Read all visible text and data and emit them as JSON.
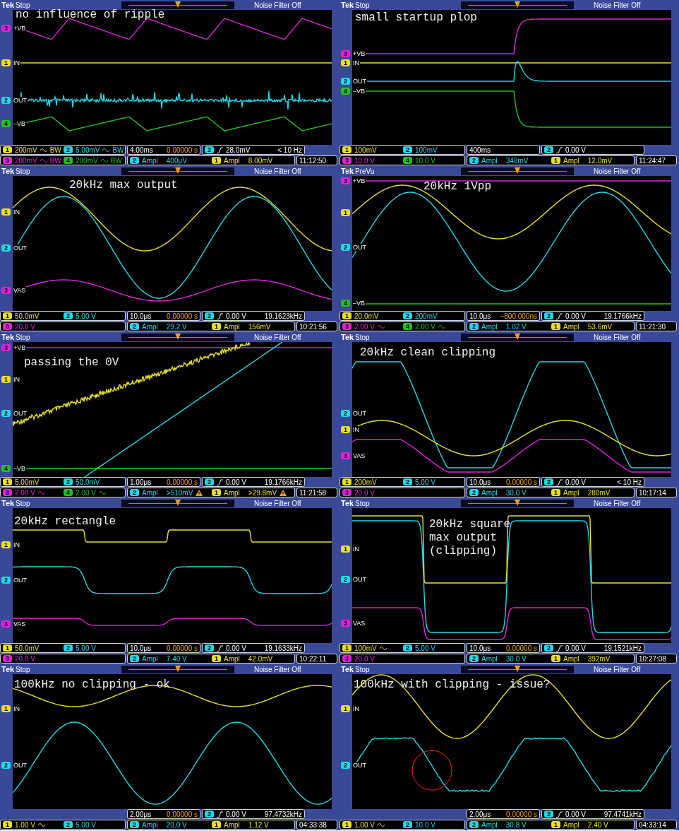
{
  "panels": [
    {
      "kind": "ripple",
      "brand": "Tek",
      "status": "Stop",
      "filter": "Noise Filter Off",
      "annotation": "no influence of ripple",
      "markers": [
        {
          "ch": "3",
          "label": "+VB",
          "color": "#e020e0"
        },
        {
          "ch": "1",
          "label": "IN",
          "color": "#e8e020"
        },
        {
          "ch": "2",
          "label": "OUT",
          "color": "#20d8e8"
        },
        {
          "ch": "4",
          "label": "–VB",
          "color": "#20c020"
        }
      ],
      "scales": [
        [
          {
            "ch": "1",
            "value": "200mV",
            "color": "#e8e020",
            "wave": true,
            "suffix": "BW"
          },
          {
            "ch": "2",
            "value": "5.00mV",
            "color": "#20d8e8",
            "wave": true,
            "suffix": "BW"
          }
        ],
        [
          {
            "ch": "3",
            "value": "200mV",
            "color": "#e020e0",
            "wave": true,
            "suffix": "BW"
          },
          {
            "ch": "4",
            "value": "200mV",
            "color": "#20c020",
            "wave": true,
            "suffix": "BW"
          }
        ]
      ],
      "timebase": "4.00ms",
      "delay": "0.00000 s",
      "trigger": {
        "ch": "2",
        "value": "28.0mV",
        "color": "#20d8e8"
      },
      "frequency": "< 10 Hz",
      "measurements": [
        {
          "ch": "2",
          "label": "Ampl",
          "value": "400μV",
          "color": "#20d8e8",
          "warning": false
        },
        {
          "ch": "1",
          "label": "Ampl",
          "value": "8.00mV",
          "color": "#e8e020",
          "warning": false
        }
      ],
      "time": "11:12:50"
    },
    {
      "kind": "startup",
      "brand": "Tek",
      "status": "Stop",
      "filter": "Noise Filter Off",
      "annotation": "small startup plop",
      "markers": [
        {
          "ch": "3",
          "label": "+VB",
          "color": "#e020e0"
        },
        {
          "ch": "1",
          "label": "IN",
          "color": "#e8e020"
        },
        {
          "ch": "2",
          "label": "OUT",
          "color": "#20d8e8"
        },
        {
          "ch": "4",
          "label": "–VB",
          "color": "#20c020"
        }
      ],
      "scales": [
        [
          {
            "ch": "1",
            "value": "100mV",
            "color": "#e8e020",
            "wave": false
          },
          {
            "ch": "2",
            "value": "100mV",
            "color": "#20d8e8",
            "wave": false
          }
        ],
        [
          {
            "ch": "3",
            "value": "10.0 V",
            "color": "#e020e0",
            "wave": false
          },
          {
            "ch": "4",
            "value": "10.0 V",
            "color": "#20c020",
            "wave": false
          }
        ]
      ],
      "timebase": "400ms",
      "trigger": {
        "ch": "2",
        "value": "0.00 V",
        "color": "#20d8e8"
      },
      "measurements": [
        {
          "ch": "2",
          "label": "Ampl",
          "value": "348mV",
          "color": "#20d8e8",
          "warning": false
        },
        {
          "ch": "1",
          "label": "Ampl",
          "value": "12.0mV",
          "color": "#e8e020",
          "warning": false
        }
      ],
      "time": "11:24:47"
    },
    {
      "kind": "sine_max",
      "brand": "Tek",
      "status": "Stop",
      "filter": "Noise Filter Off",
      "annotation": "20kHz max output",
      "markers": [
        {
          "ch": "1",
          "label": "IN",
          "color": "#e8e020"
        },
        {
          "ch": "2",
          "label": "OUT",
          "color": "#20d8e8"
        },
        {
          "ch": "3",
          "label": "VAS",
          "color": "#e020e0"
        }
      ],
      "scales": [
        [
          {
            "ch": "1",
            "value": "50.0mV",
            "color": "#e8e020",
            "wave": false
          },
          {
            "ch": "2",
            "value": "5.00 V",
            "color": "#20d8e8",
            "wave": false
          }
        ],
        [
          {
            "ch": "3",
            "value": "20.0 V",
            "color": "#e020e0",
            "wave": false
          }
        ]
      ],
      "timebase": "10.0μs",
      "delay": "0.00000 s",
      "trigger": {
        "ch": "2",
        "value": "0.00 V",
        "color": "#20d8e8"
      },
      "frequency": "19.1623kHz",
      "measurements": [
        {
          "ch": "2",
          "label": "Ampl",
          "value": "29.2 V",
          "color": "#20d8e8",
          "warning": false
        },
        {
          "ch": "1",
          "label": "Ampl",
          "value": "156mV",
          "color": "#e8e020",
          "warning": false
        }
      ],
      "time": "10:21:56"
    },
    {
      "kind": "sine_1vpp",
      "brand": "Tek",
      "status": "PreVu",
      "filter": "Noise Filter Off",
      "annotation": "20kHz 1Vpp",
      "markers": [
        {
          "ch": "3",
          "label": "+VB",
          "color": "#e020e0"
        },
        {
          "ch": "1",
          "color": "#e8e020"
        },
        {
          "ch": "2",
          "label": "OUT",
          "color": "#20d8e8"
        },
        {
          "ch": "4",
          "label": "–VB",
          "color": "#20c020"
        }
      ],
      "scales": [
        [
          {
            "ch": "1",
            "value": "20.0mV",
            "color": "#e8e020",
            "wave": false
          },
          {
            "ch": "2",
            "value": "200mV",
            "color": "#20d8e8",
            "wave": false
          }
        ],
        [
          {
            "ch": "3",
            "value": "2.00 V",
            "color": "#e020e0",
            "wave": true
          },
          {
            "ch": "4",
            "value": "2.00 V",
            "color": "#20c020",
            "wave": true
          }
        ]
      ],
      "timebase": "10.0μs",
      "delay": "−800.000ns",
      "trigger": {
        "ch": "2",
        "value": "0.00 V",
        "color": "#20d8e8"
      },
      "frequency": "19.1766kHz",
      "measurements": [
        {
          "ch": "2",
          "label": "Ampl",
          "value": "1.02 V",
          "color": "#20d8e8",
          "warning": false
        },
        {
          "ch": "1",
          "label": "Ampl",
          "value": "53.6mV",
          "color": "#e8e020",
          "warning": false
        }
      ],
      "time": "11:21:30"
    },
    {
      "kind": "zero_cross",
      "brand": "Tek",
      "status": "Stop",
      "filter": "Noise Filter Off",
      "annotation": "passing the 0V",
      "markers": [
        {
          "ch": "3",
          "label": "+VB",
          "color": "#e020e0"
        },
        {
          "ch": "1",
          "label": "IN",
          "color": "#e8e020"
        },
        {
          "ch": "2",
          "label": "OUT",
          "color": "#20d8e8"
        },
        {
          "ch": "4",
          "label": "–VB",
          "color": "#20c020"
        }
      ],
      "scales": [
        [
          {
            "ch": "1",
            "value": "5.00mV",
            "color": "#e8e020",
            "wave": false
          },
          {
            "ch": "2",
            "value": "50.0mV",
            "color": "#20d8e8",
            "wave": false
          }
        ],
        [
          {
            "ch": "3",
            "value": "2.00 V",
            "color": "#e020e0",
            "wave": true
          },
          {
            "ch": "4",
            "value": "2.00 V",
            "color": "#20c020",
            "wave": true
          }
        ]
      ],
      "timebase": "1.00μs",
      "delay": "0.00000 s",
      "trigger": {
        "ch": "2",
        "value": "0.00 V",
        "color": "#20d8e8"
      },
      "frequency": "19.1766kHz",
      "measurements": [
        {
          "ch": "2",
          "label": "Ampl",
          "value": ">510mV",
          "color": "#20d8e8",
          "warning": true
        },
        {
          "ch": "1",
          "label": "Ampl",
          "value": ">29.8mV",
          "color": "#e8e020",
          "warning": true
        }
      ],
      "time": "11:21:58"
    },
    {
      "kind": "clean_clip",
      "brand": "Tek",
      "status": "Stop",
      "filter": "Noise Filter Off",
      "annotation": "20kHz clean clipping",
      "markers": [
        {
          "ch": "2",
          "label": "OUT",
          "color": "#20d8e8"
        },
        {
          "ch": "1",
          "label": "IN",
          "color": "#e8e020"
        },
        {
          "ch": "3",
          "label": "VAS",
          "color": "#e020e0"
        }
      ],
      "scales": [
        [
          {
            "ch": "1",
            "value": "200mV",
            "color": "#e8e020",
            "wave": false
          },
          {
            "ch": "2",
            "value": "5.00 V",
            "color": "#20d8e8",
            "wave": false
          }
        ],
        [
          {
            "ch": "3",
            "value": "20.0 V",
            "color": "#e020e0",
            "wave": false
          }
        ]
      ],
      "timebase": "10.0μs",
      "delay": "0.00000 s",
      "trigger": {
        "ch": "2",
        "value": "0.00 V",
        "color": "#20d8e8"
      },
      "frequency": "< 10 Hz",
      "measurements": [
        {
          "ch": "2",
          "label": "Ampl",
          "value": "30.0 V",
          "color": "#20d8e8",
          "warning": false
        },
        {
          "ch": "1",
          "label": "Ampl",
          "value": "280mV",
          "color": "#e8e020",
          "warning": false
        }
      ],
      "time": "10:17:14"
    },
    {
      "kind": "rectangle",
      "brand": "Tek",
      "status": "Stop",
      "filter": "Noise Filter Off",
      "annotation": "20kHz rectangle",
      "markers": [
        {
          "ch": "1",
          "label": "IN",
          "color": "#e8e020"
        },
        {
          "ch": "2",
          "label": "OUT",
          "color": "#20d8e8"
        },
        {
          "ch": "3",
          "label": "VAS",
          "color": "#e020e0"
        }
      ],
      "scales": [
        [
          {
            "ch": "1",
            "value": "50.0mV",
            "color": "#e8e020",
            "wave": false
          },
          {
            "ch": "2",
            "value": "5.00 V",
            "color": "#20d8e8",
            "wave": false
          }
        ],
        [
          {
            "ch": "3",
            "value": "20.0 V",
            "color": "#e020e0",
            "wave": false
          }
        ]
      ],
      "timebase": "10.0μs",
      "delay": "0.00000 s",
      "trigger": {
        "ch": "2",
        "value": "0.00 V",
        "color": "#20d8e8"
      },
      "frequency": "19.1633kHz",
      "measurements": [
        {
          "ch": "2",
          "label": "Ampl",
          "value": "7.40 V",
          "color": "#20d8e8",
          "warning": false
        },
        {
          "ch": "1",
          "label": "Ampl",
          "value": "42.0mV",
          "color": "#e8e020",
          "warning": false
        }
      ],
      "time": "10:22:11"
    },
    {
      "kind": "square_clip",
      "brand": "Tek",
      "status": "Stop",
      "filter": "Noise Filter Off",
      "annotation": "20kHz square\nmax output\n(clipping)",
      "markers": [
        {
          "ch": "1",
          "label": "IN",
          "color": "#e8e020"
        },
        {
          "ch": "2",
          "label": "OUT",
          "color": "#20d8e8"
        },
        {
          "ch": "3",
          "label": "VAS",
          "color": "#e020e0"
        }
      ],
      "scales": [
        [
          {
            "ch": "1",
            "value": "100mV",
            "color": "#e8e020",
            "wave": true
          },
          {
            "ch": "2",
            "value": "5.00 V",
            "color": "#20d8e8",
            "wave": false
          }
        ],
        [
          {
            "ch": "3",
            "value": "20.0 V",
            "color": "#e020e0",
            "wave": false
          }
        ]
      ],
      "timebase": "10.0μs",
      "delay": "0.00000 s",
      "trigger": {
        "ch": "2",
        "value": "0.00 V",
        "color": "#20d8e8"
      },
      "frequency": "19.1521kHz",
      "measurements": [
        {
          "ch": "2",
          "label": "Ampl",
          "value": "30.0 V",
          "color": "#20d8e8",
          "warning": false
        },
        {
          "ch": "1",
          "label": "Ampl",
          "value": "392mV",
          "color": "#e8e020",
          "warning": false
        }
      ],
      "time": "10:27:08"
    },
    {
      "kind": "sine_100k",
      "brand": "Tek",
      "status": "Stop",
      "filter": "Noise Filter Off",
      "annotation": "100kHz no clipping - ok",
      "markers": [
        {
          "ch": "1",
          "label": "IN",
          "color": "#e8e020"
        },
        {
          "ch": "2",
          "label": "OUT",
          "color": "#20d8e8"
        }
      ],
      "scales": [
        [
          {
            "ch": "1",
            "value": "1.00 V",
            "color": "#e8e020",
            "wave": true
          },
          {
            "ch": "2",
            "value": "5.00 V",
            "color": "#20d8e8",
            "wave": false
          }
        ]
      ],
      "timebase": "2.00μs",
      "delay": "0.00000 s",
      "trigger": {
        "ch": "2",
        "value": "0.00 V",
        "color": "#20d8e8"
      },
      "frequency": "97.4732kHz",
      "measurements": [
        {
          "ch": "2",
          "label": "Ampl",
          "value": "20.0 V",
          "color": "#20d8e8",
          "warning": false
        },
        {
          "ch": "1",
          "label": "Ampl",
          "value": "1.12 V",
          "color": "#e8e020",
          "warning": false
        }
      ],
      "time": "04:33:38"
    },
    {
      "kind": "sine_clip",
      "brand": "Tek",
      "status": "Stop",
      "filter": "Noise Filter Off",
      "annotation": "100kHz with clipping - issue?",
      "markers": [
        {
          "ch": "1",
          "label": "IN",
          "color": "#e8e020"
        },
        {
          "ch": "2",
          "label": "OUT",
          "color": "#20d8e8"
        }
      ],
      "scales": [
        [
          {
            "ch": "1",
            "value": "1.00 V",
            "color": "#e8e020",
            "wave": true
          },
          {
            "ch": "2",
            "value": "10.0 V",
            "color": "#20d8e8",
            "wave": false
          }
        ]
      ],
      "timebase": "2.00μs",
      "delay": "0.00000 s",
      "trigger": {
        "ch": "2",
        "value": "0.00 V",
        "color": "#20d8e8"
      },
      "frequency": "97.4741kHz",
      "measurements": [
        {
          "ch": "2",
          "label": "Ampl",
          "value": "30.8 V",
          "color": "#20d8e8",
          "warning": false
        },
        {
          "ch": "1",
          "label": "Ampl",
          "value": "2.40 V",
          "color": "#e8e020",
          "warning": false
        }
      ],
      "time": "04:33:14"
    }
  ]
}
